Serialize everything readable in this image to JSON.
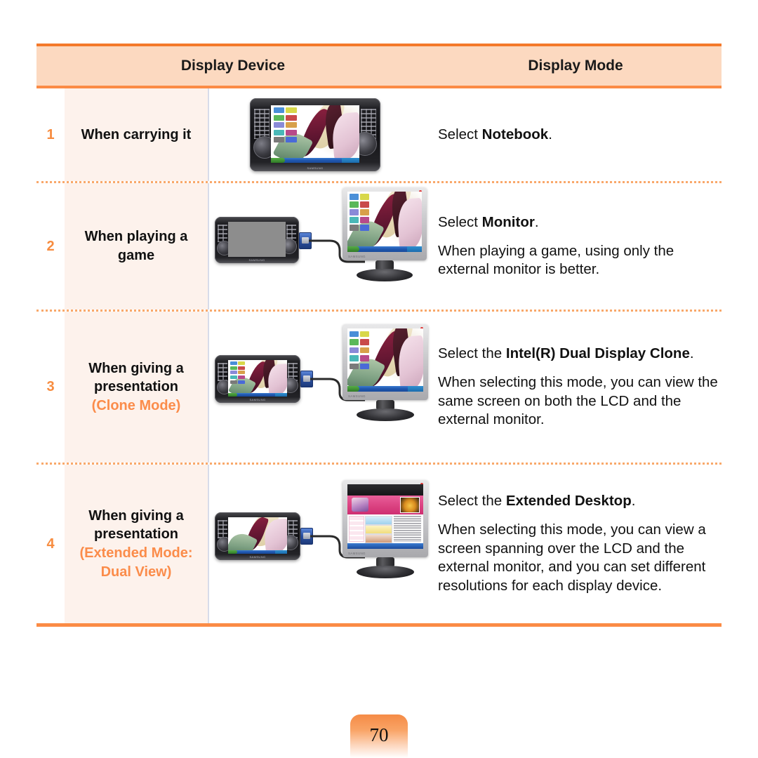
{
  "table": {
    "headers": {
      "device": "Display Device",
      "mode": "Display Mode"
    },
    "rows": [
      {
        "number": "1",
        "label_lines": [
          "When carrying it"
        ],
        "label_accent": "",
        "image": "umpc-tablet-only",
        "desc_primary_prefix": "Select ",
        "desc_primary_bold": "Notebook",
        "desc_primary_suffix": ".",
        "desc_secondary": ""
      },
      {
        "number": "2",
        "label_lines": [
          "When playing a",
          "game"
        ],
        "label_accent": "",
        "image": "umpc-blank-to-monitor",
        "desc_primary_prefix": "Select ",
        "desc_primary_bold": "Monitor",
        "desc_primary_suffix": ".",
        "desc_secondary": "When playing a game, using only the external monitor is better."
      },
      {
        "number": "3",
        "label_lines": [
          "When giving a",
          "presentation"
        ],
        "label_accent": "(Clone Mode)",
        "image": "umpc-clone-to-monitor",
        "desc_primary_prefix": "Select the ",
        "desc_primary_bold": "Intel(R) Dual Display Clone",
        "desc_primary_suffix": ".",
        "desc_secondary": "When selecting this mode, you can view the same screen on both the LCD and the external monitor."
      },
      {
        "number": "4",
        "label_lines": [
          "When giving a",
          "presentation"
        ],
        "label_accent": "(Extended Mode: Dual View)",
        "image": "umpc-extended-to-monitor",
        "desc_primary_prefix": "Select the ",
        "desc_primary_bold": "Extended Desktop",
        "desc_primary_suffix": ".",
        "desc_secondary": "When selecting this mode, you can view a screen spanning over the LCD and the external monitor, and you can set different resolutions for each display device."
      }
    ]
  },
  "footer": {
    "page_number": "70"
  },
  "colors": {
    "header_fill": "#fcd9c0",
    "header_border_top": "#f4792b",
    "header_border_bottom": "#fb8b45",
    "label_column_fill": "#fdf2ec",
    "accent_orange": "#fb8c4a",
    "number_orange": "#f78c3f",
    "divider_blue_gray": "#d7dcea",
    "dotted_separator": "#f9a86a"
  }
}
